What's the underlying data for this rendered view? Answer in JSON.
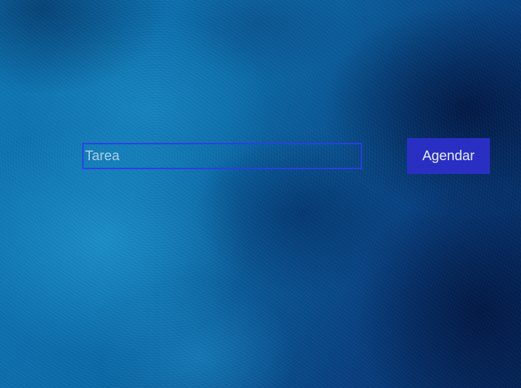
{
  "task_form": {
    "task_input": {
      "placeholder": "Tarea",
      "value": ""
    },
    "schedule_button": {
      "label": "Agendar"
    }
  },
  "colors": {
    "input_border": "#2c3ee8",
    "button_background": "#2a2fc4",
    "background_primary": "#0a5d9a",
    "background_dark": "#04285f"
  }
}
